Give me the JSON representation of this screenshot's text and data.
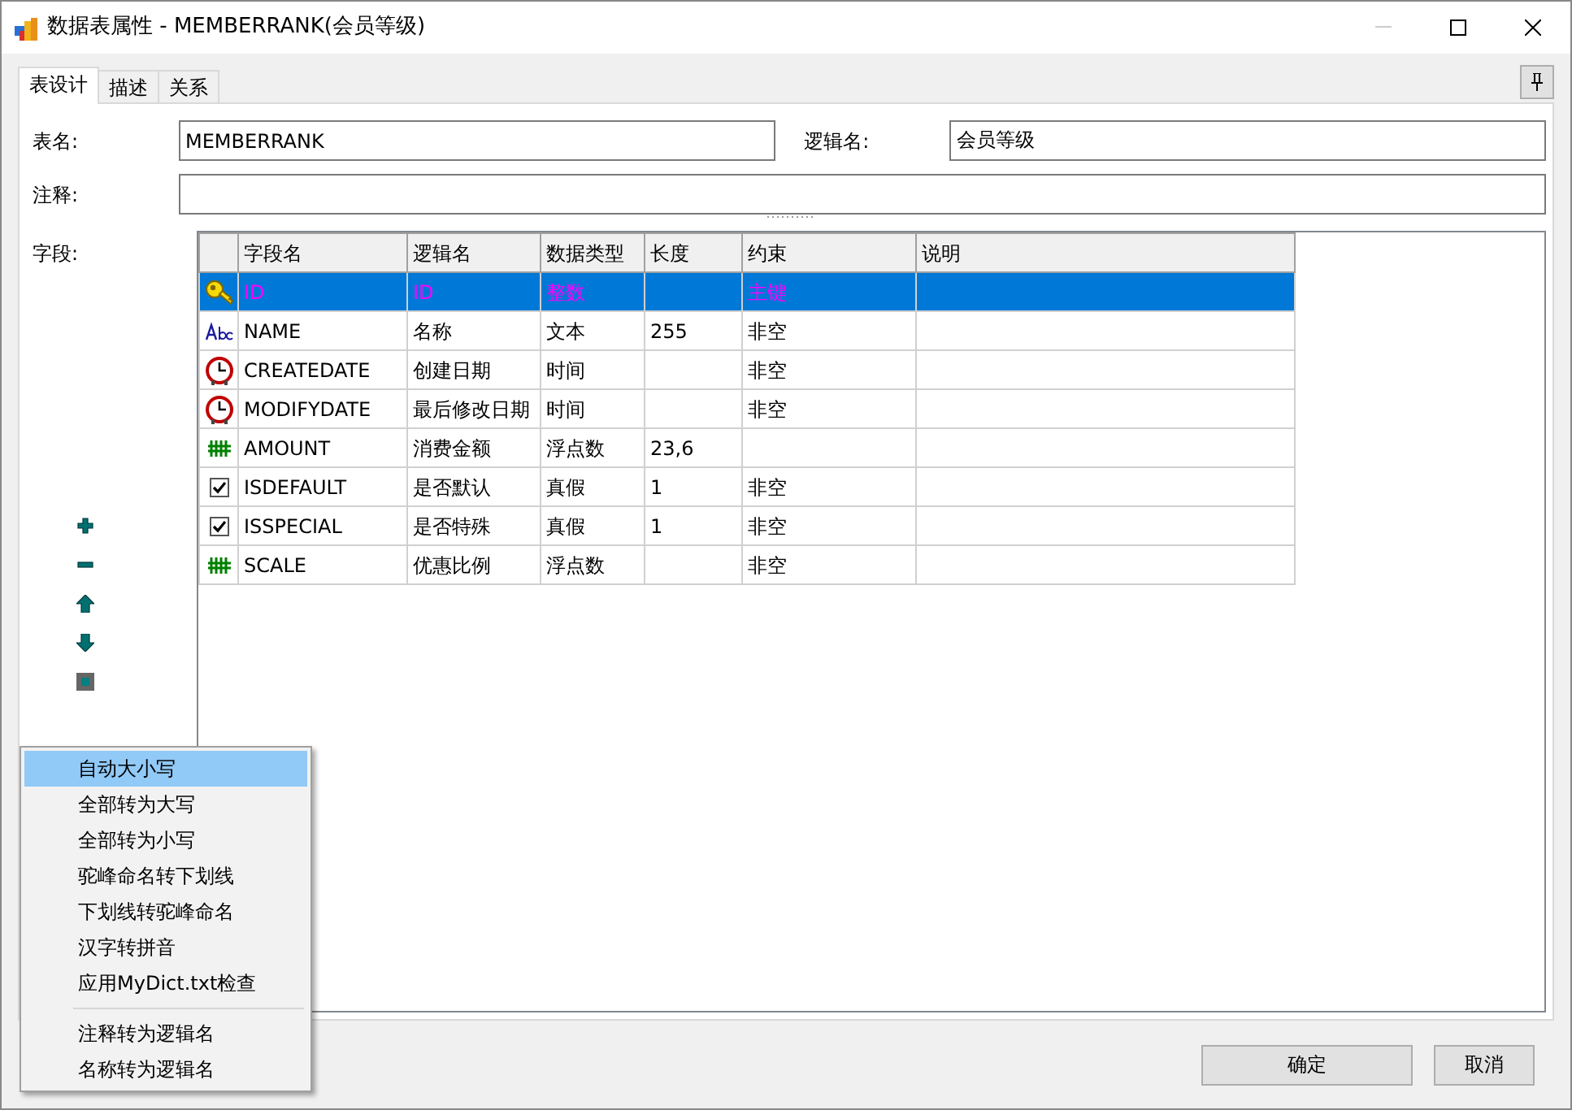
{
  "window": {
    "title": "数据表属性 - MEMBERRANK(会员等级)"
  },
  "tabs": [
    {
      "label": "表设计",
      "selected": true
    },
    {
      "label": "描述",
      "selected": false
    },
    {
      "label": "关系",
      "selected": false
    }
  ],
  "form": {
    "table_name_label": "表名:",
    "table_name": "MEMBERRANK",
    "logical_name_label": "逻辑名:",
    "logical_name": "会员等级",
    "comment_label": "注释:",
    "fields_label": "字段:"
  },
  "grid": {
    "columns": [
      "字段名",
      "逻辑名",
      "数据类型",
      "长度",
      "约束",
      "说明"
    ],
    "rows": [
      {
        "kind": "key",
        "selected": true,
        "cells": [
          "ID",
          "ID",
          "整数",
          "",
          "主键",
          ""
        ]
      },
      {
        "kind": "text",
        "selected": false,
        "cells": [
          "NAME",
          "名称",
          "文本",
          "255",
          "非空",
          ""
        ]
      },
      {
        "kind": "time",
        "selected": false,
        "cells": [
          "CREATEDATE",
          "创建日期",
          "时间",
          "",
          "非空",
          ""
        ]
      },
      {
        "kind": "time",
        "selected": false,
        "cells": [
          "MODIFYDATE",
          "最后修改日期",
          "时间",
          "",
          "非空",
          ""
        ]
      },
      {
        "kind": "number",
        "selected": false,
        "cells": [
          "AMOUNT",
          "消费金额",
          "浮点数",
          "23,6",
          "",
          ""
        ]
      },
      {
        "kind": "bool",
        "selected": false,
        "cells": [
          "ISDEFAULT",
          "是否默认",
          "真假",
          "1",
          "非空",
          ""
        ]
      },
      {
        "kind": "bool",
        "selected": false,
        "cells": [
          "ISSPECIAL",
          "是否特殊",
          "真假",
          "1",
          "非空",
          ""
        ]
      },
      {
        "kind": "number",
        "selected": false,
        "cells": [
          "SCALE",
          "优惠比例",
          "浮点数",
          "",
          "非空",
          ""
        ]
      }
    ]
  },
  "context_menu": [
    {
      "label": "自动大小写",
      "selected": true,
      "separator_before": false
    },
    {
      "label": "全部转为大写",
      "selected": false,
      "separator_before": false
    },
    {
      "label": "全部转为小写",
      "selected": false,
      "separator_before": false
    },
    {
      "label": "驼峰命名转下划线",
      "selected": false,
      "separator_before": false
    },
    {
      "label": "下划线转驼峰命名",
      "selected": false,
      "separator_before": false
    },
    {
      "label": "汉字转拼音",
      "selected": false,
      "separator_before": false
    },
    {
      "label": "应用MyDict.txt检查",
      "selected": false,
      "separator_before": false
    },
    {
      "label": "注释转为逻辑名",
      "selected": false,
      "separator_before": true
    },
    {
      "label": "名称转为逻辑名",
      "selected": false,
      "separator_before": false
    }
  ],
  "buttons": [
    "确定",
    "取消"
  ]
}
